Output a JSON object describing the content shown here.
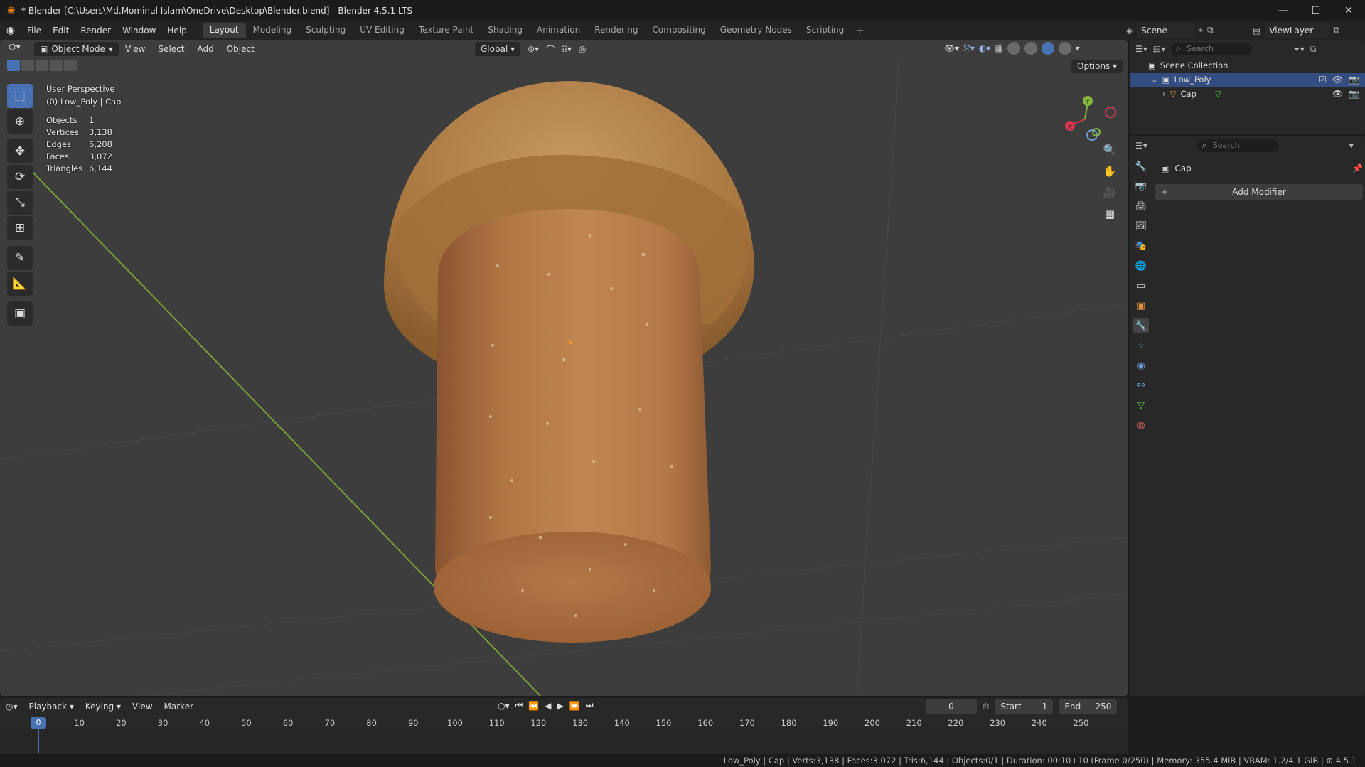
{
  "window": {
    "title": "* Blender [C:\\Users\\Md.Mominul Islam\\OneDrive\\Desktop\\Blender.blend] - Blender 4.5.1 LTS"
  },
  "menu": {
    "items": [
      "File",
      "Edit",
      "Render",
      "Window",
      "Help"
    ]
  },
  "workspaces": {
    "tabs": [
      "Layout",
      "Modeling",
      "Sculpting",
      "UV Editing",
      "Texture Paint",
      "Shading",
      "Animation",
      "Rendering",
      "Compositing",
      "Geometry Nodes",
      "Scripting"
    ],
    "active": "Layout"
  },
  "scene": {
    "name": "Scene",
    "view_layer": "ViewLayer"
  },
  "viewport": {
    "mode": "Object Mode",
    "menus": [
      "View",
      "Select",
      "Add",
      "Object"
    ],
    "orientation": "Global",
    "options_label": "Options",
    "perspective": "User Perspective",
    "context": "(0) Low_Poly | Cap",
    "stats": [
      {
        "label": "Objects",
        "value": "1"
      },
      {
        "label": "Vertices",
        "value": "3,138"
      },
      {
        "label": "Edges",
        "value": "6,208"
      },
      {
        "label": "Faces",
        "value": "3,072"
      },
      {
        "label": "Triangles",
        "value": "6,144"
      }
    ],
    "gizmo": {
      "y_label": "Y",
      "x_label": "X"
    },
    "colors": {
      "grid_bg": "#3d3d3d",
      "x_axis": "#d6394f",
      "y_axis": "#86b83a",
      "cork": "#a86a3a",
      "cap": "#b78650",
      "selection": "#4772b3"
    }
  },
  "outliner": {
    "search_placeholder": "Search",
    "root": "Scene Collection",
    "collection": "Low_Poly",
    "object": "Cap"
  },
  "properties": {
    "search_placeholder": "Search",
    "object_name": "Cap",
    "add_modifier": "Add Modifier"
  },
  "timeline": {
    "menus": [
      "Playback",
      "Keying",
      "View",
      "Marker"
    ],
    "current_frame": "0",
    "start_label": "Start",
    "start": "1",
    "end_label": "End",
    "end": "250",
    "ruler": [
      "0",
      "10",
      "20",
      "30",
      "40",
      "50",
      "60",
      "70",
      "80",
      "90",
      "100",
      "110",
      "120",
      "130",
      "140",
      "150",
      "160",
      "170",
      "180",
      "190",
      "200",
      "210",
      "220",
      "230",
      "240",
      "250"
    ]
  },
  "statusbar": {
    "text": "Low_Poly | Cap | Verts:3,138 | Faces:3,072 | Tris:6,144 | Objects:0/1 | Duration: 00:10+10 (Frame 0/250) | Memory: 355.4 MiB | VRAM: 1.2/4.1 GiB | ⊕ 4.5.1"
  }
}
